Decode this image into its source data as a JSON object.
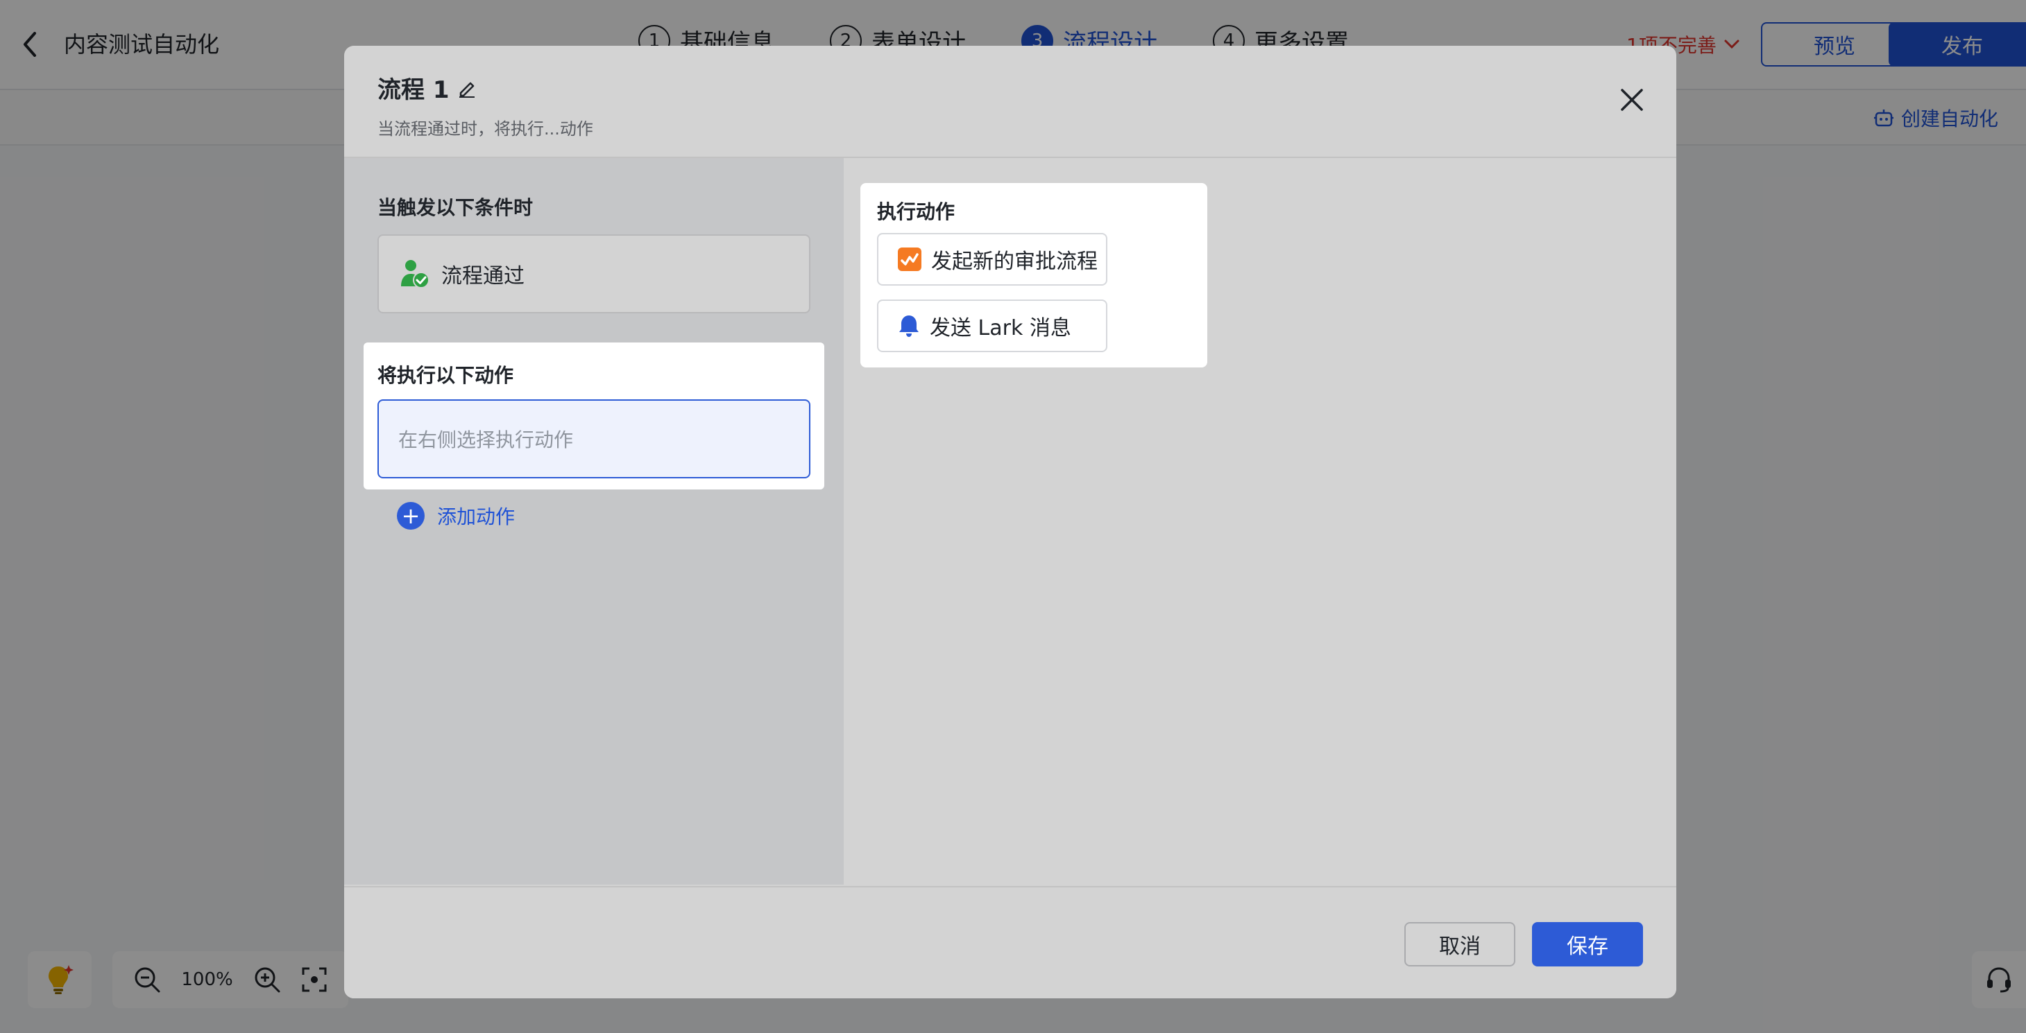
{
  "header": {
    "back_icon": "chevron-left-icon",
    "app_title": "内容测试自动化",
    "steps": [
      {
        "num": "1",
        "label": "基础信息",
        "active": false
      },
      {
        "num": "2",
        "label": "表单设计",
        "active": false
      },
      {
        "num": "3",
        "label": "流程设计",
        "active": true
      },
      {
        "num": "4",
        "label": "更多设置",
        "active": false
      }
    ],
    "incomplete_text": "1项不完善",
    "preview_label": "预览",
    "publish_label": "发布"
  },
  "subbar": {
    "create_automation_label": "创建自动化"
  },
  "canvas_tools": {
    "zoom_level": "100%"
  },
  "modal": {
    "title": "流程 1",
    "subtitle": "当流程通过时，将执行...动作",
    "left": {
      "trigger_section_title": "当触发以下条件时",
      "trigger_label": "流程通过",
      "action_section_title": "将执行以下动作",
      "action_placeholder": "在右侧选择执行动作",
      "add_action_label": "添加动作"
    },
    "right": {
      "panel_title": "执行动作",
      "actions": [
        {
          "label": "发起新的审批流程",
          "icon": "approval-flow-icon"
        },
        {
          "label": "发送 Lark 消息",
          "icon": "bell-icon"
        }
      ]
    },
    "footer": {
      "cancel_label": "取消",
      "save_label": "保存"
    }
  },
  "colors": {
    "accent": "#1f52d6",
    "warning": "#e0342c",
    "approval_icon": "#f57a22",
    "trigger_icon": "#2ea043"
  }
}
